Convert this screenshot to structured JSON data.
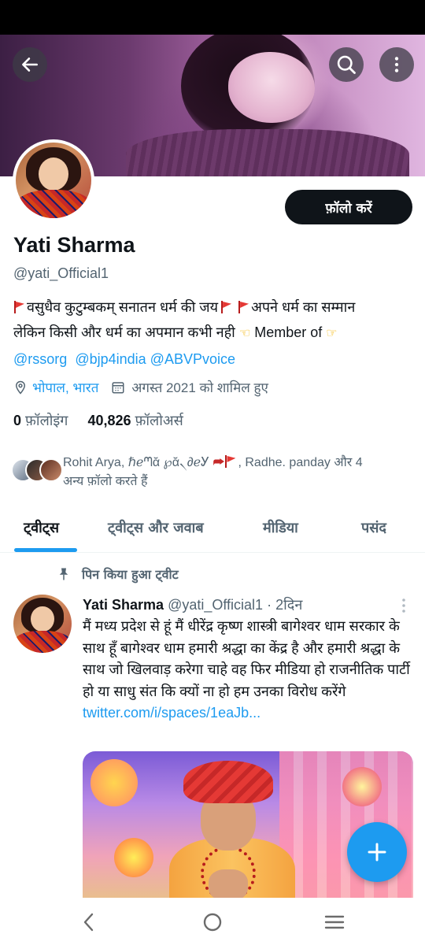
{
  "profile": {
    "follow_label": "फ़ॉलो करें",
    "name": "Yati Sharma",
    "handle": "@yati_Official1",
    "bio": {
      "line1_a": "वसुधैव कुटुम्बकम् सनातन धर्म की जय",
      "line1_b": "अपने धर्म का सम्मान",
      "line2_a": "लेकिन किसी और धर्म का अपमान कभी नही",
      "line2_b": "Member of",
      "mentions": [
        "@rssorg",
        "@bjp4india",
        "@ABVPvoice"
      ]
    },
    "location": "भोपाल, भारत",
    "joined": "अगस्त 2021 को शामिल हुए",
    "following_count": "0",
    "following_label": "फ़ॉलोइंग",
    "followers_count": "40,826",
    "followers_label": "फ़ॉलोअर्स",
    "followed_by_line1": "Rohit Arya, ℏℯᘉᾰ ℘ᾰ৲∂ℯᎩ",
    "followed_by_line1_b": ", Radhe. panday और 4",
    "followed_by_line2": "अन्य फ़ॉलो करते हैं"
  },
  "tabs": [
    {
      "label": "ट्वीट्स",
      "active": true
    },
    {
      "label": "ट्वीट्स और जवाब",
      "active": false
    },
    {
      "label": "मीडिया",
      "active": false
    },
    {
      "label": "पसंद",
      "active": false
    }
  ],
  "pinned_tweet": {
    "pinned_label": "पिन किया हुआ ट्वीट",
    "author_name": "Yati Sharma",
    "author_handle": "@yati_Official1",
    "separator": "·",
    "time": "2दिन",
    "text": "मैं मध्य प्रदेश से हूं मैं धीरेंद्र कृष्ण शास्त्री बागेश्वर धाम सरकार के साथ हूँ बागेश्वर धाम हमारी श्रद्धा का केंद्र है और हमारी श्रद्धा के साथ जो खिलवाड़ करेगा चाहे वह फिर मीडिया हो राजनीतिक पार्टी हो या साधु संत कि क्यों ना हो हम उनका विरोध करेंगे",
    "link": "twitter.com/i/spaces/1eaJb..."
  },
  "colors": {
    "accent": "#1d9bf0",
    "primary_text": "#0f1419",
    "secondary_text": "#536471",
    "follow_button": "#0f1419"
  },
  "icons": {
    "back": "back-arrow-icon",
    "search": "search-icon",
    "more": "more-vertical-icon",
    "location": "location-pin-icon",
    "calendar": "calendar-icon",
    "pin": "pin-icon",
    "compose": "plus-icon",
    "nav_back": "nav-back-icon",
    "nav_home": "nav-home-icon",
    "nav_recents": "nav-recents-icon"
  }
}
